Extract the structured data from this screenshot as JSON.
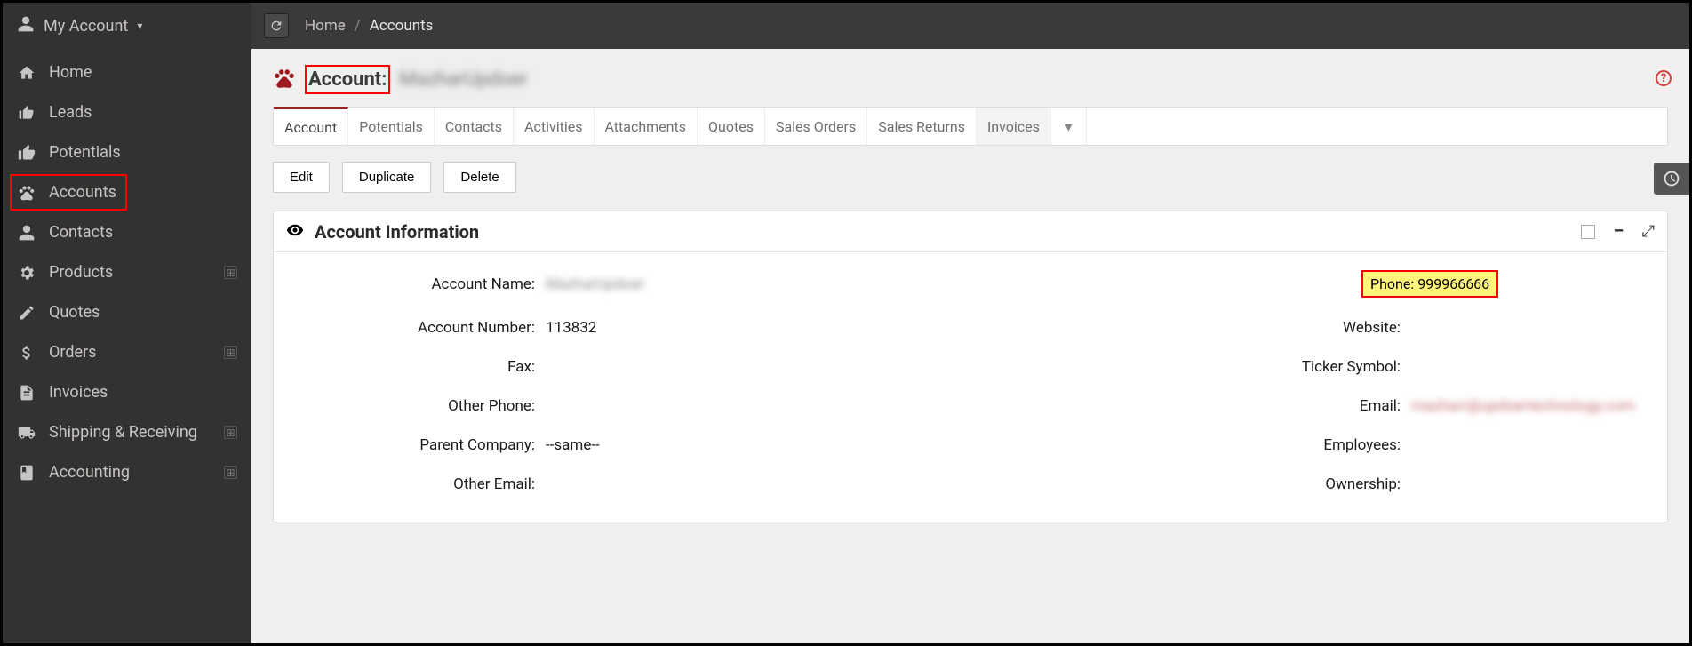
{
  "header": {
    "account_menu_label": "My Account",
    "breadcrumb": {
      "home": "Home",
      "sep": "/",
      "current": "Accounts"
    }
  },
  "sidebar": {
    "items": [
      {
        "label": "Home",
        "icon": "home-icon",
        "expandable": false
      },
      {
        "label": "Leads",
        "icon": "thumbs-up-icon",
        "expandable": false
      },
      {
        "label": "Potentials",
        "icon": "thumbs-up-solid-icon",
        "expandable": false
      },
      {
        "label": "Accounts",
        "icon": "paw-icon",
        "expandable": false,
        "active": true
      },
      {
        "label": "Contacts",
        "icon": "user-icon",
        "expandable": false
      },
      {
        "label": "Products",
        "icon": "gears-icon",
        "expandable": true
      },
      {
        "label": "Quotes",
        "icon": "edit-icon",
        "expandable": false
      },
      {
        "label": "Orders",
        "icon": "dollar-icon",
        "expandable": true
      },
      {
        "label": "Invoices",
        "icon": "file-icon",
        "expandable": false
      },
      {
        "label": "Shipping & Receiving",
        "icon": "truck-icon",
        "expandable": true
      },
      {
        "label": "Accounting",
        "icon": "book-icon",
        "expandable": true
      }
    ]
  },
  "page": {
    "title_label": "Account:",
    "title_value": "MazharUpdoer"
  },
  "tabs": {
    "items": [
      {
        "label": "Account",
        "active": true
      },
      {
        "label": "Potentials"
      },
      {
        "label": "Contacts"
      },
      {
        "label": "Activities"
      },
      {
        "label": "Attachments"
      },
      {
        "label": "Quotes"
      },
      {
        "label": "Sales Orders"
      },
      {
        "label": "Sales Returns"
      },
      {
        "label": "Invoices"
      }
    ]
  },
  "actions": {
    "edit": "Edit",
    "duplicate": "Duplicate",
    "delete": "Delete"
  },
  "panel": {
    "title": "Account Information",
    "fields": {
      "account_name": {
        "label": "Account Name:",
        "value": "MazharUpdoer"
      },
      "phone": {
        "label": "Phone:",
        "value": "999966666"
      },
      "account_number": {
        "label": "Account Number:",
        "value": "113832"
      },
      "website": {
        "label": "Website:",
        "value": ""
      },
      "fax": {
        "label": "Fax:",
        "value": ""
      },
      "ticker_symbol": {
        "label": "Ticker Symbol:",
        "value": ""
      },
      "other_phone": {
        "label": "Other Phone:",
        "value": ""
      },
      "email": {
        "label": "Email:",
        "value": "mazharr@updoertechnology.com"
      },
      "parent_company": {
        "label": "Parent Company:",
        "value": "--same--"
      },
      "employees": {
        "label": "Employees:",
        "value": ""
      },
      "other_email": {
        "label": "Other Email:",
        "value": ""
      },
      "ownership": {
        "label": "Ownership:",
        "value": ""
      }
    }
  }
}
